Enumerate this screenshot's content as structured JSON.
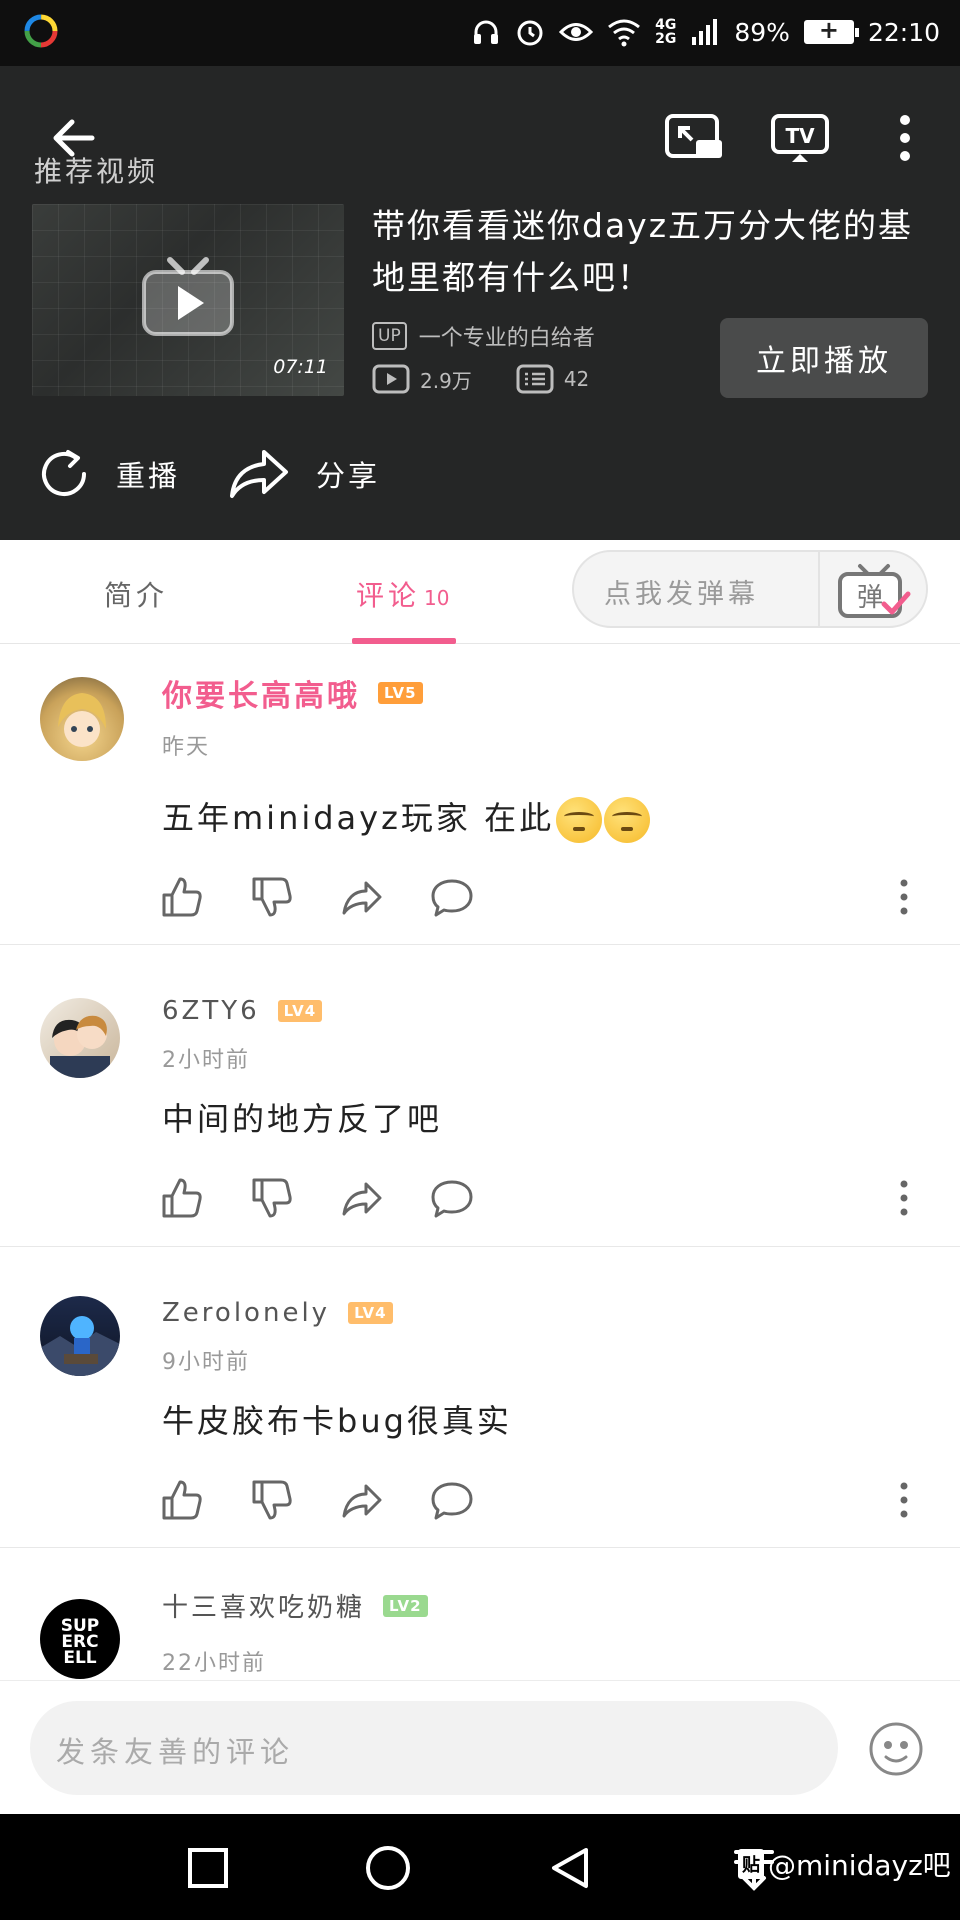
{
  "status_bar": {
    "battery": "89%",
    "time": "22:10",
    "net_top": "4G",
    "net_bottom": "2G"
  },
  "player": {
    "recommend_label": "推荐视频",
    "duration": "07:11",
    "title": "带你看看迷你dayz五万分大佬的基地里都有什么吧！",
    "up_badge": "UP",
    "uploader": "一个专业的白给者",
    "views": "2.9万",
    "danmaku_count": "42",
    "play_now": "立即播放",
    "replay": "重播",
    "share": "分享"
  },
  "tabs": {
    "intro": "简介",
    "comments": "评论",
    "comments_count": "10",
    "danmaku_placeholder": "点我发弹幕"
  },
  "comments": [
    {
      "username": "你要长高高哦",
      "level": "LV5",
      "time": "昨天",
      "content": "五年minidayz玩家 在此"
    },
    {
      "username": "6ZTY6",
      "level": "LV4",
      "time": "2小时前",
      "content": "中间的地方反了吧"
    },
    {
      "username": "Zerolonely",
      "level": "LV4",
      "time": "9小时前",
      "content": "牛皮胶布卡bug很真实"
    },
    {
      "username": "十三喜欢吃奶糖",
      "level": "LV2",
      "time": "22小时前",
      "content": ""
    }
  ],
  "avatar_text": {
    "supercell": "SUPERCELL"
  },
  "input": {
    "placeholder": "发条友善的评论"
  },
  "watermark": {
    "badge": "贴",
    "text": "@minidayz吧"
  },
  "colors": {
    "accent": "#f25d8e",
    "header_bg": "#252626"
  }
}
